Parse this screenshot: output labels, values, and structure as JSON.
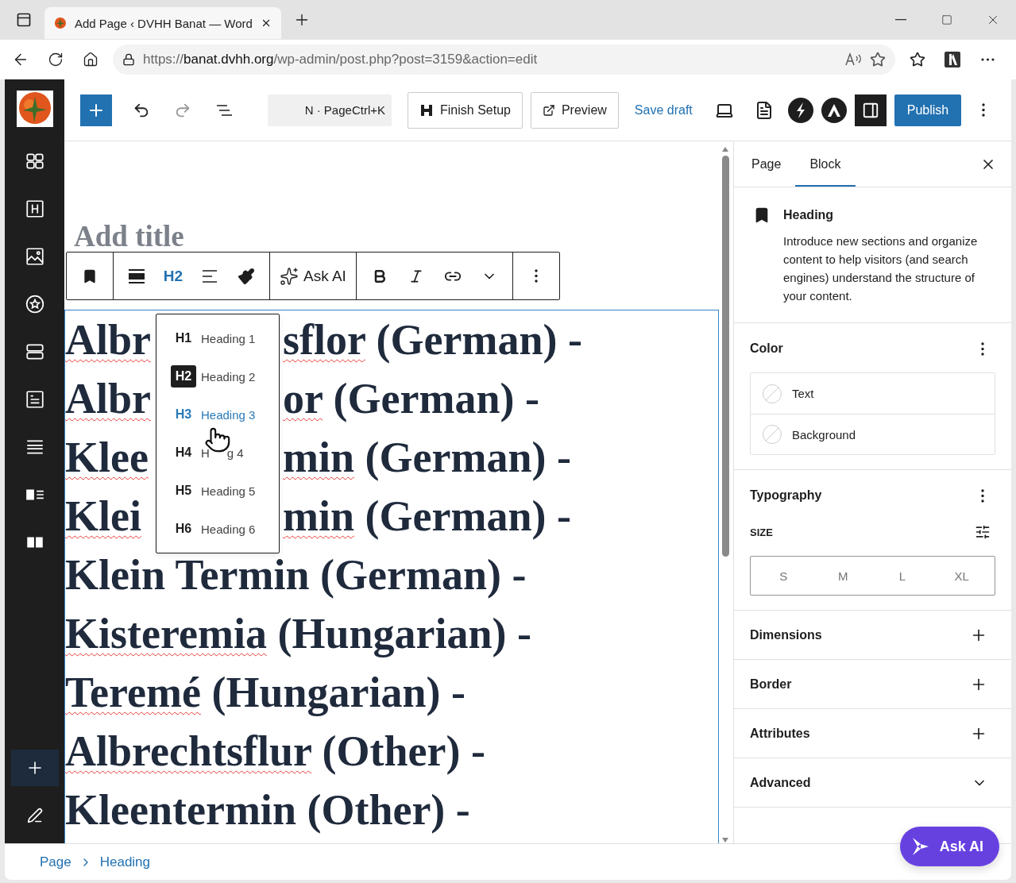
{
  "browser": {
    "tab_title": "Add Page ‹ DVHH Banat — Word",
    "url": {
      "scheme": "https://",
      "host": "banat.dvhh.org",
      "path": "/wp-admin/post.php?post=3159&action=edit"
    }
  },
  "left_sidebar": {
    "add_button_active": true
  },
  "top_toolbar": {
    "command_hint": "N · PageCtrl+K",
    "finish_setup": "Finish Setup",
    "preview": "Preview",
    "save_draft": "Save draft",
    "sidebar_open": true,
    "publish": "Publish"
  },
  "editor": {
    "title_placeholder": "Add title",
    "block_toolbar": {
      "heading_level": "H2",
      "ask_ai": "Ask AI"
    },
    "heading_menu": {
      "items": [
        {
          "tag": "H1",
          "label": "Heading 1",
          "selected": false,
          "hovered": false
        },
        {
          "tag": "H2",
          "label": "Heading 2",
          "selected": true,
          "hovered": false
        },
        {
          "tag": "H3",
          "label": "Heading 3",
          "selected": false,
          "hovered": true
        },
        {
          "tag": "H4",
          "label": "H",
          "label_end": "g 4",
          "selected": false,
          "hovered": false
        },
        {
          "tag": "H5",
          "label": "Heading 5",
          "selected": false,
          "hovered": false
        },
        {
          "tag": "H6",
          "label": "Heading 6",
          "selected": false,
          "hovered": false
        }
      ]
    },
    "heading_lines": [
      {
        "segments": [
          {
            "text": "Albr",
            "misspelled": true
          }
        ],
        "after_menu": [
          {
            "text": "sflor",
            "misspelled": true
          },
          {
            "text": " (German) -",
            "misspelled": false
          }
        ]
      },
      {
        "segments": [
          {
            "text": "Albr",
            "misspelled": true
          }
        ],
        "after_menu": [
          {
            "text": "or",
            "misspelled": true
          },
          {
            "text": " (German) -",
            "misspelled": false
          }
        ]
      },
      {
        "segments": [
          {
            "text": "Klee",
            "misspelled": true
          }
        ],
        "after_menu": [
          {
            "text": "min",
            "misspelled": true
          },
          {
            "text": " (German) -",
            "misspelled": false
          }
        ]
      },
      {
        "segments": [
          {
            "text": "Klei",
            "misspelled": true
          }
        ],
        "after_menu": [
          {
            "text": "min",
            "misspelled": true
          },
          {
            "text": " (German) -",
            "misspelled": false
          }
        ]
      },
      {
        "segments": [
          {
            "text": "Klein Termin (German) -",
            "misspelled": false
          }
        ]
      },
      {
        "segments": [
          {
            "text": "Kisteremia",
            "misspelled": true
          },
          {
            "text": " (Hungarian) -",
            "misspelled": false
          }
        ]
      },
      {
        "segments": [
          {
            "text": "Teremé",
            "misspelled": true
          },
          {
            "text": " (Hungarian) -",
            "misspelled": false
          }
        ]
      },
      {
        "segments": [
          {
            "text": "Albrechtsflur",
            "misspelled": true
          },
          {
            "text": " (Other) -",
            "misspelled": false
          }
        ]
      },
      {
        "segments": [
          {
            "text": "Kleentermin (Other) -",
            "misspelled": false
          }
        ]
      }
    ]
  },
  "settings": {
    "tabs": [
      {
        "label": "Page",
        "selected": false
      },
      {
        "label": "Block",
        "selected": true
      }
    ],
    "block": {
      "name": "Heading",
      "description": "Introduce new sections and organize content to help visitors (and search engines) understand the structure of your content."
    },
    "color": {
      "title": "Color",
      "items": [
        {
          "label": "Text"
        },
        {
          "label": "Background"
        }
      ]
    },
    "typography": {
      "title": "Typography",
      "size_label": "SIZE",
      "sizes": [
        {
          "label": "S",
          "selected": false
        },
        {
          "label": "M",
          "selected": false
        },
        {
          "label": "L",
          "selected": false
        },
        {
          "label": "XL",
          "selected": false
        }
      ]
    },
    "panels": [
      {
        "title": "Dimensions",
        "kind": "add"
      },
      {
        "title": "Border",
        "kind": "add"
      },
      {
        "title": "Attributes",
        "kind": "add"
      },
      {
        "title": "Advanced",
        "kind": "collapse"
      }
    ]
  },
  "ask_ai_button": "Ask AI",
  "breadcrumb": [
    "Page",
    "Heading"
  ]
}
